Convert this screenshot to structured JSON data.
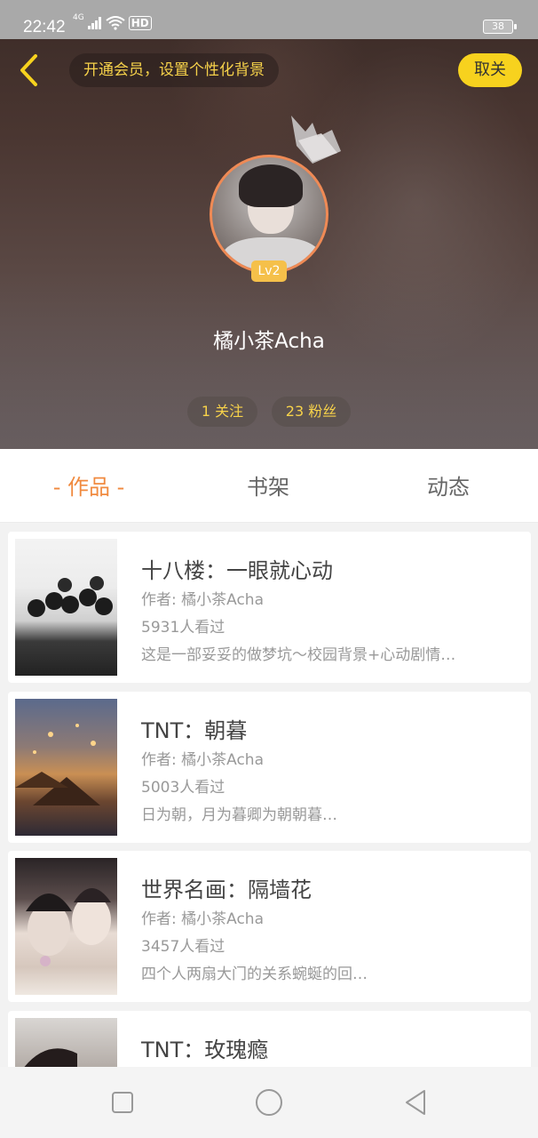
{
  "status_bar": {
    "time": "22:42",
    "network": "4G",
    "wifi_label": "HD",
    "battery": "38"
  },
  "header": {
    "vip_banner": "开通会员，设置个性化背景",
    "unfollow_label": "取关",
    "username": "橘小茶Acha",
    "level": "Lv2",
    "follow_stat": "1 关注",
    "fans_stat": "23 粉丝",
    "accent_color": "#f7d21e"
  },
  "tabs": [
    {
      "label": "- 作品 -",
      "active": true
    },
    {
      "label": "书架",
      "active": false
    },
    {
      "label": "动态",
      "active": false
    }
  ],
  "works": [
    {
      "title": "十八楼：一眼就心动",
      "author": "作者: 橘小茶Acha",
      "views": "5931人看过",
      "description": "这是一部妥妥的做梦坑～校园背景+心动剧情…"
    },
    {
      "title": "TNT：朝暮",
      "author": "作者: 橘小茶Acha",
      "views": "5003人看过",
      "description": "日为朝，月为暮卿为朝朝暮…"
    },
    {
      "title": "世界名画：隔墙花",
      "author": "作者: 橘小茶Acha",
      "views": "3457人看过",
      "description": "四个人两扇大门的关系蜿蜒的回…"
    },
    {
      "title": "TNT：玫瑰瘾",
      "author": "",
      "views": "",
      "description": ""
    }
  ]
}
